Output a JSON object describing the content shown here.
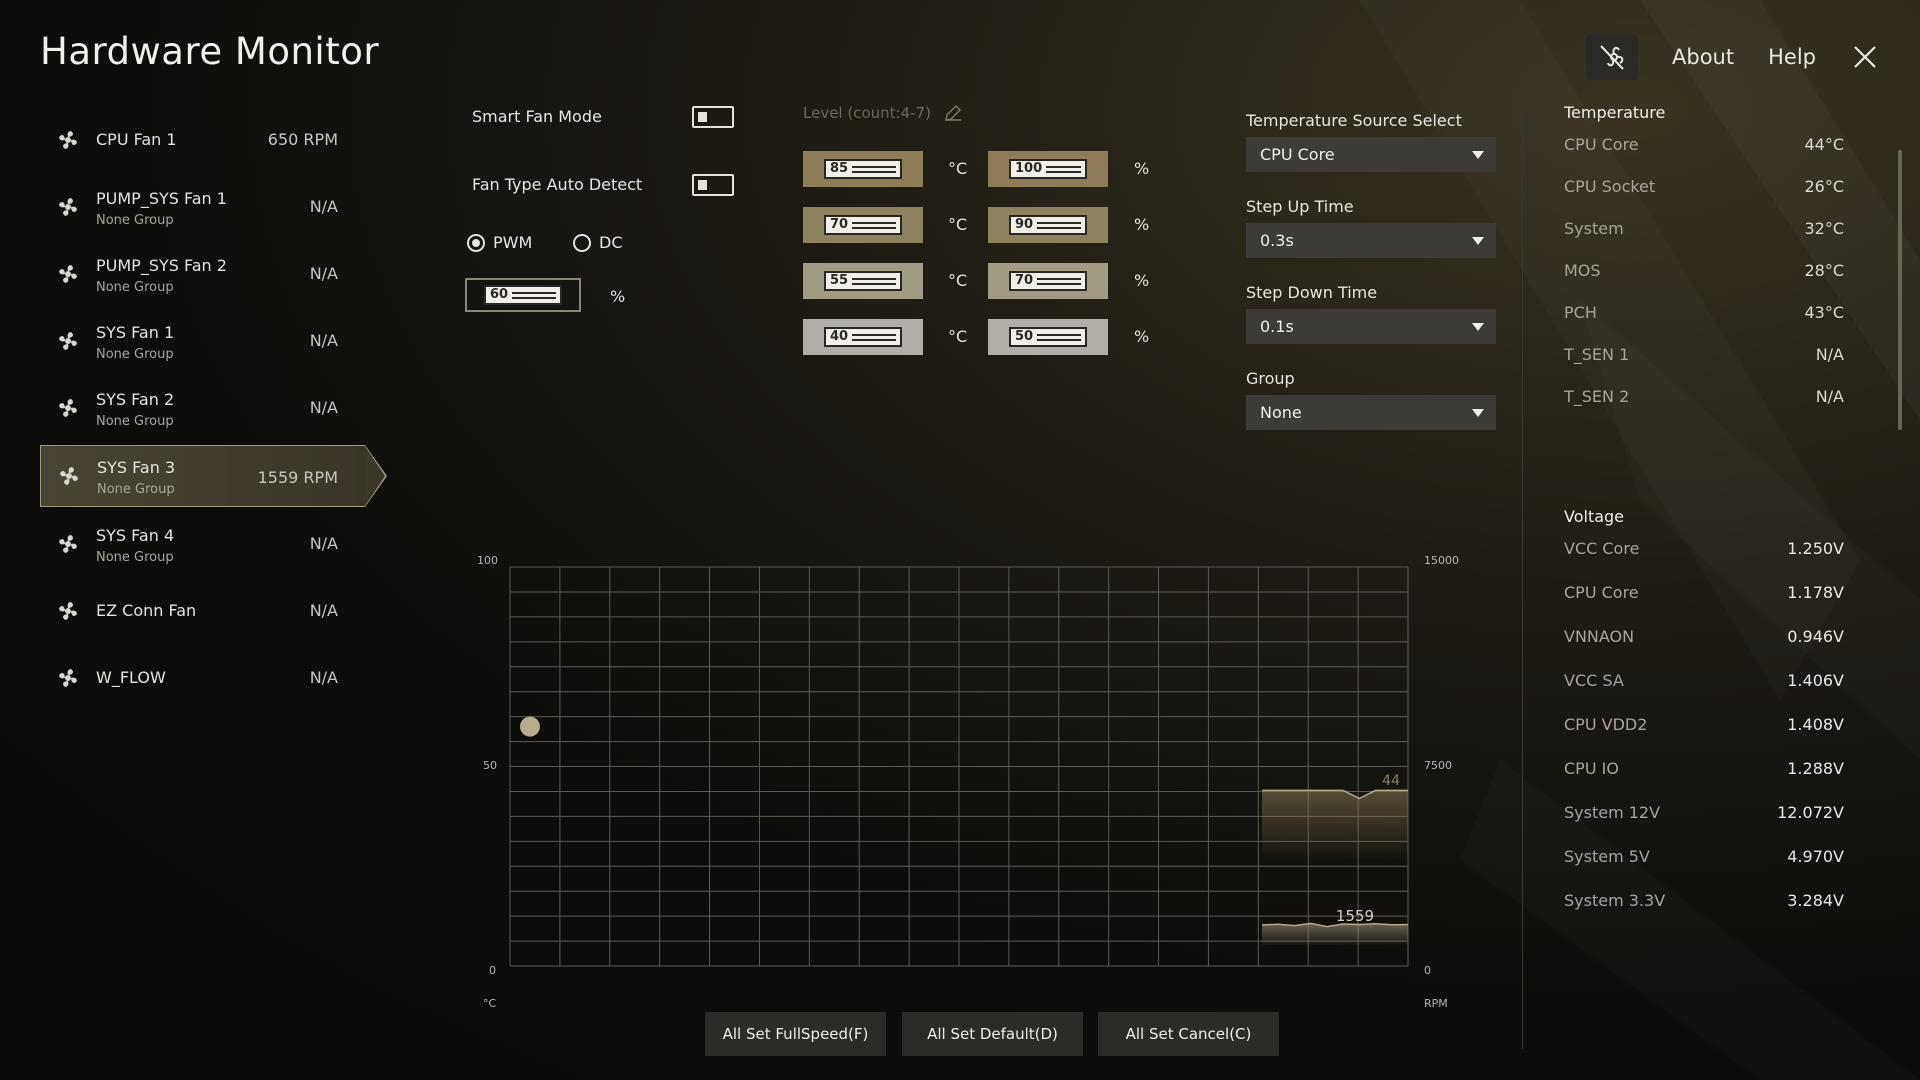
{
  "app": {
    "title": "Hardware Monitor"
  },
  "topbar": {
    "about": "About",
    "help": "Help"
  },
  "fans": [
    {
      "name": "CPU Fan 1",
      "group": "",
      "rpm": "650 RPM",
      "selected": false
    },
    {
      "name": "PUMP_SYS Fan 1",
      "group": "None Group",
      "rpm": "N/A",
      "selected": false
    },
    {
      "name": "PUMP_SYS Fan 2",
      "group": "None Group",
      "rpm": "N/A",
      "selected": false
    },
    {
      "name": "SYS Fan 1",
      "group": "None Group",
      "rpm": "N/A",
      "selected": false
    },
    {
      "name": "SYS Fan 2",
      "group": "None Group",
      "rpm": "N/A",
      "selected": false
    },
    {
      "name": "SYS Fan 3",
      "group": "None Group",
      "rpm": "1559 RPM",
      "selected": true
    },
    {
      "name": "SYS Fan 4",
      "group": "None Group",
      "rpm": "N/A",
      "selected": false
    },
    {
      "name": "EZ Conn Fan",
      "group": "",
      "rpm": "N/A",
      "selected": false
    },
    {
      "name": "W_FLOW",
      "group": "",
      "rpm": "N/A",
      "selected": false
    }
  ],
  "controls": {
    "smart_fan_mode": "Smart Fan Mode",
    "fan_type_auto_detect": "Fan Type Auto Detect",
    "pwm": "PWM",
    "dc": "DC",
    "speed_value": "60",
    "percent": "%",
    "level_label": "Level (count:4-7)",
    "celsius": "°C"
  },
  "levels": [
    {
      "temp": "85",
      "speed": "100"
    },
    {
      "temp": "70",
      "speed": "90"
    },
    {
      "temp": "55",
      "speed": "70"
    },
    {
      "temp": "40",
      "speed": "50"
    }
  ],
  "settings": {
    "temp_source_label": "Temperature Source Select",
    "temp_source_value": "CPU Core",
    "step_up_label": "Step Up Time",
    "step_up_value": "0.3s",
    "step_down_label": "Step Down Time",
    "step_down_value": "0.1s",
    "group_label": "Group",
    "group_value": "None"
  },
  "temperature": {
    "title": "Temperature",
    "rows": [
      {
        "label": "CPU Core",
        "value": "44°C"
      },
      {
        "label": "CPU Socket",
        "value": "26°C"
      },
      {
        "label": "System",
        "value": "32°C"
      },
      {
        "label": "MOS",
        "value": "28°C"
      },
      {
        "label": "PCH",
        "value": "43°C"
      },
      {
        "label": "T_SEN 1",
        "value": "N/A"
      },
      {
        "label": "T_SEN 2",
        "value": "N/A"
      }
    ]
  },
  "voltage": {
    "title": "Voltage",
    "rows": [
      {
        "label": "VCC Core",
        "value": "1.250V"
      },
      {
        "label": "CPU Core",
        "value": "1.178V"
      },
      {
        "label": "VNNAON",
        "value": "0.946V"
      },
      {
        "label": "VCC SA",
        "value": "1.406V"
      },
      {
        "label": "CPU VDD2",
        "value": "1.408V"
      },
      {
        "label": "CPU IO",
        "value": "1.288V"
      },
      {
        "label": "System 12V",
        "value": "12.072V"
      },
      {
        "label": "System 5V",
        "value": "4.970V"
      },
      {
        "label": "System 3.3V",
        "value": "3.284V"
      }
    ]
  },
  "chart": {
    "left_ticks": [
      "100",
      "50",
      "0"
    ],
    "right_ticks": [
      "15000",
      "7500",
      "0"
    ],
    "left_unit": "°C",
    "right_unit": "RPM",
    "temp_readout": "44",
    "rpm_readout": "1559"
  },
  "chart_data": {
    "type": "line",
    "ylim": [
      0,
      100
    ],
    "y2lim": [
      0,
      15000
    ],
    "ylabel": "°C",
    "y2label": "RPM",
    "grid": true,
    "curve_point": {
      "x": 0,
      "y": 60
    },
    "series": [
      {
        "values": [
          44,
          44,
          44,
          44,
          44,
          44,
          42,
          44,
          44,
          44
        ]
      },
      {
        "values": [
          1540,
          1570,
          1520,
          1600,
          1480,
          1580,
          1560,
          1590,
          1550,
          1559
        ]
      }
    ]
  },
  "buttons": {
    "full_speed": "All Set FullSpeed(F)",
    "default": "All Set Default(D)",
    "cancel": "All Set Cancel(C)"
  }
}
